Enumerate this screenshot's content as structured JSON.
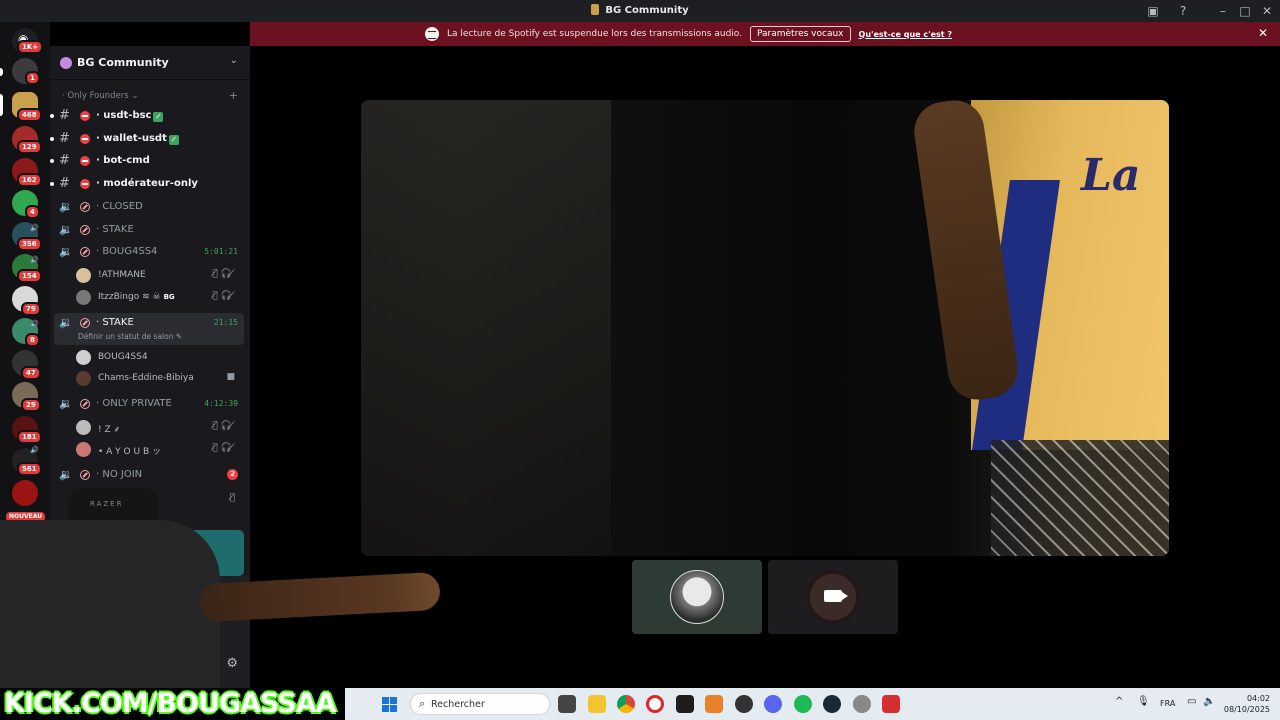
{
  "window": {
    "title": "BG Community"
  },
  "banner": {
    "message": "La lecture de Spotify est suspendue lors des transmissions audio.",
    "button": "Paramètres vocaux",
    "link": "Qu'est-ce que c'est ?"
  },
  "rail": {
    "badges": [
      "1K+",
      "1",
      "468",
      "129",
      "162",
      "4",
      "356",
      "154",
      "79",
      "8",
      "47",
      "29",
      "181",
      "561"
    ],
    "new_label": "NOUVEAU"
  },
  "server": {
    "name": "BG Community",
    "category": "Only Founders"
  },
  "channels": [
    {
      "label": "usdt-bsc",
      "type": "text",
      "verified": true
    },
    {
      "label": "wallet-usdt",
      "type": "text",
      "verified": true
    },
    {
      "label": "bot-cmd",
      "type": "text"
    },
    {
      "label": "modérateur-only",
      "type": "text"
    },
    {
      "label": "CLOSED",
      "type": "voice"
    },
    {
      "label": "STAKE",
      "type": "voice"
    },
    {
      "label": "BOUG4SS4",
      "type": "voice",
      "time": "5:01:21"
    },
    {
      "label": "STAKE",
      "type": "voice",
      "time": "21:15",
      "status": "Définir un statut de salon"
    },
    {
      "label": "ONLY PRIVATE",
      "type": "voice",
      "time": "4:12:39"
    },
    {
      "label": "NO JOIN",
      "type": "voice",
      "count": "2"
    }
  ],
  "members": {
    "boug4ss4": [
      "!ATHMANE",
      "ItzzBingo"
    ],
    "stake": [
      "BOUG4SS4",
      "Chams-Eddine-Bibiya"
    ],
    "only_private": [
      "! Z ⸙",
      "• A Y O U B ッ"
    ],
    "tag": "BG"
  },
  "watermark": "KICK.COM/BOUGASSAA",
  "taskbar": {
    "search_placeholder": "Rechercher",
    "language": "FRA",
    "time": "04:02",
    "date": "08/10/2025"
  },
  "colors": {
    "accent_green": "#3ba55d",
    "banner_red": "#6c1120",
    "kick_green": "#53fc18"
  }
}
